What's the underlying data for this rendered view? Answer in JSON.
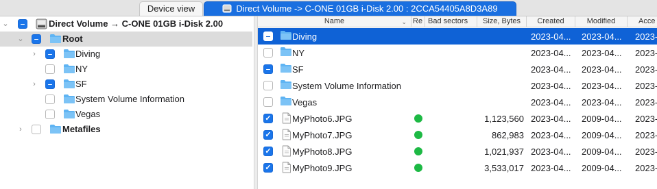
{
  "tabs": {
    "device_view": "Device view",
    "volume_view": "Direct Volume -> C-ONE 01GB i-Disk 2.00 : 2CCA54405A8D3A89"
  },
  "tree": {
    "root_volume": "Direct Volume → C-ONE 01GB i-Disk 2.00",
    "root_folder": "Root",
    "items": [
      {
        "label": "Diving",
        "check": "mixed",
        "expandable": true
      },
      {
        "label": "NY",
        "check": "empty",
        "expandable": false
      },
      {
        "label": "SF",
        "check": "mixed",
        "expandable": true
      },
      {
        "label": "System Volume Information",
        "check": "empty",
        "expandable": false
      },
      {
        "label": "Vegas",
        "check": "empty",
        "expandable": false
      }
    ],
    "metafiles": "Metafiles"
  },
  "table": {
    "columns": {
      "name": "Name",
      "re": "Re",
      "bad_sectors": "Bad sectors",
      "size": "Size, Bytes",
      "created": "Created",
      "modified": "Modified",
      "accessed": "Acce"
    },
    "rows": [
      {
        "name": "Diving",
        "type": "folder",
        "check": "mixed",
        "status": "",
        "size": "",
        "created": "2023-04...",
        "modified": "2023-04...",
        "accessed": "2023-",
        "selected": true
      },
      {
        "name": "NY",
        "type": "folder",
        "check": "empty",
        "status": "",
        "size": "",
        "created": "2023-04...",
        "modified": "2023-04...",
        "accessed": "2023-",
        "selected": false
      },
      {
        "name": "SF",
        "type": "folder",
        "check": "mixed",
        "status": "",
        "size": "",
        "created": "2023-04...",
        "modified": "2023-04...",
        "accessed": "2023-",
        "selected": false
      },
      {
        "name": "System Volume Information",
        "type": "folder",
        "check": "empty",
        "status": "",
        "size": "",
        "created": "2023-04...",
        "modified": "2023-04...",
        "accessed": "2023-",
        "selected": false
      },
      {
        "name": "Vegas",
        "type": "folder",
        "check": "empty",
        "status": "",
        "size": "",
        "created": "2023-04...",
        "modified": "2023-04...",
        "accessed": "2023-",
        "selected": false
      },
      {
        "name": "MyPhoto6.JPG",
        "type": "file",
        "check": "checked",
        "status": "green",
        "size": "1,123,560",
        "created": "2023-04...",
        "modified": "2009-04...",
        "accessed": "2023-",
        "selected": false
      },
      {
        "name": "MyPhoto7.JPG",
        "type": "file",
        "check": "checked",
        "status": "green",
        "size": "862,983",
        "created": "2023-04...",
        "modified": "2009-04...",
        "accessed": "2023-",
        "selected": false
      },
      {
        "name": "MyPhoto8.JPG",
        "type": "file",
        "check": "checked",
        "status": "green",
        "size": "1,021,937",
        "created": "2023-04...",
        "modified": "2009-04...",
        "accessed": "2023-",
        "selected": false
      },
      {
        "name": "MyPhoto9.JPG",
        "type": "file",
        "check": "checked",
        "status": "green",
        "size": "3,533,017",
        "created": "2023-04...",
        "modified": "2009-04...",
        "accessed": "2023-",
        "selected": false
      }
    ]
  },
  "colors": {
    "accent": "#1a75ea",
    "selection": "#0f62d6",
    "folder": "#5fb4f3",
    "status_ok": "#1db944"
  }
}
